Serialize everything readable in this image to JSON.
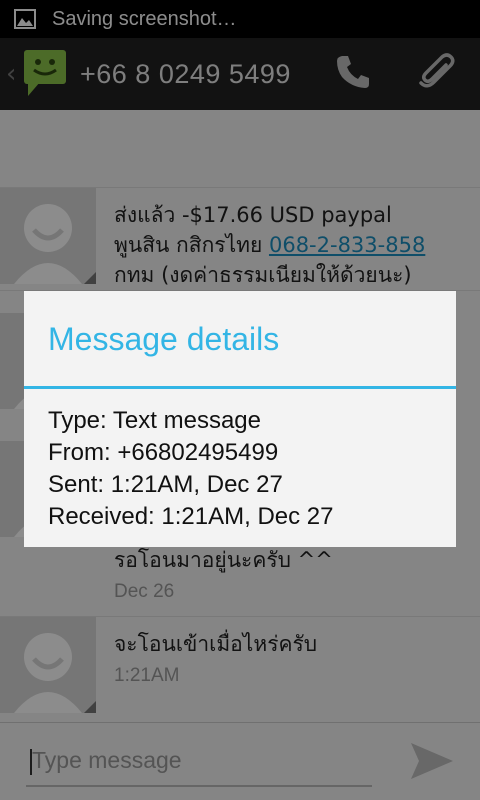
{
  "status_bar": {
    "notification_icon": "image-icon",
    "text": "Saving screenshot…"
  },
  "action_bar": {
    "title": "+66 8 0249 5499",
    "app_icon": "messaging-icon",
    "call_icon": "phone-icon",
    "attach_icon": "paperclip-icon"
  },
  "messages": [
    {
      "line1": "ส่งแล้ว -$17.66 USD paypal",
      "line2_prefix": "พูนสิน กสิกรไทย ",
      "line2_link": "068-2-833-858",
      "line3": "กทม (งดค่าธรรมเนียมให้ด้วยนะ)"
    },
    {
      "text": "รอโอนมาอยู่นะครับ ^^",
      "date": "Dec 26"
    },
    {
      "text": "จะโอนเข้าเมื่อไหร่ครับ",
      "date": "1:21AM"
    }
  ],
  "compose": {
    "placeholder": "Type message",
    "send_icon": "send-icon"
  },
  "dialog": {
    "title": "Message details",
    "type": "Type: Text message",
    "from": "From: +66802495499",
    "sent": "Sent: 1:21AM, Dec 27",
    "received": "Received: 1:21AM, Dec 27"
  },
  "colors": {
    "accent": "#33b5e5",
    "link": "#1c8fbf",
    "action_bar": "#222222",
    "status_bar": "#000000"
  }
}
